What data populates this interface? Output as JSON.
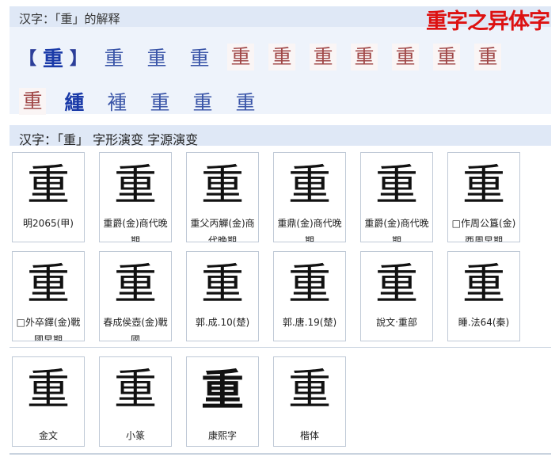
{
  "section1": {
    "title": "汉字：「重」的解释",
    "watermark": "重字之异体字",
    "open_bracket": "【",
    "main_char": "重",
    "close_bracket": "】",
    "row1_chars": [
      "重",
      "重",
      "重"
    ],
    "row1_imgs": [
      "重",
      "重",
      "重",
      "重",
      "重",
      "重",
      "重"
    ],
    "row2": [
      {
        "char": "重",
        "kind": "img"
      },
      {
        "char": "緟",
        "kind": "bold"
      },
      {
        "char": "褈",
        "kind": "text"
      },
      {
        "char": "重",
        "kind": "text"
      },
      {
        "char": "重",
        "kind": "text"
      },
      {
        "char": "重",
        "kind": "text"
      }
    ]
  },
  "section2": {
    "title": "汉字：「重」 字形演变 字源演变",
    "cards": [
      {
        "glyph": "重",
        "caption": "明2065(甲)"
      },
      {
        "glyph": "重",
        "caption": "重爵(金)商代晚期"
      },
      {
        "glyph": "重",
        "caption": "重父丙觶(金)商代晚期"
      },
      {
        "glyph": "重",
        "caption": "重鼎(金)商代晚期"
      },
      {
        "glyph": "重",
        "caption": "重爵(金)商代晚期"
      },
      {
        "glyph": "重",
        "caption": "□作周公簋(金)西周早期"
      },
      {
        "glyph": "重",
        "caption": "□外卒鐸(金)戰國早期"
      },
      {
        "glyph": "重",
        "caption": "春成侯壺(金)戰國"
      },
      {
        "glyph": "重",
        "caption": "郭.成.10(楚)"
      },
      {
        "glyph": "重",
        "caption": "郭.唐.19(楚)"
      },
      {
        "glyph": "重",
        "caption": "說文‧重部"
      },
      {
        "glyph": "重",
        "caption": "睡.法64(秦)"
      },
      {
        "glyph": "重",
        "caption": "金文"
      },
      {
        "glyph": "重",
        "caption": "小篆"
      },
      {
        "glyph": "重",
        "caption": "康熙字"
      },
      {
        "glyph": "重",
        "caption": "楷体"
      }
    ]
  }
}
